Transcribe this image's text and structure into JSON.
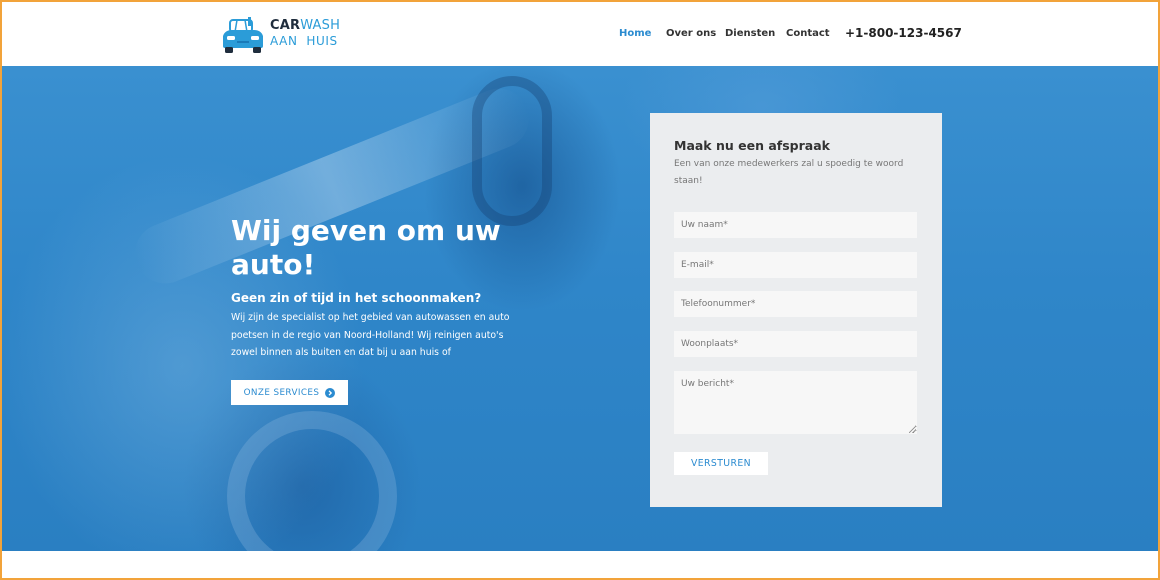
{
  "logo": {
    "text_bold": "CAR",
    "text_light": "WASH",
    "text_sub": "AAN  HUIS",
    "icon": "car-icon",
    "color_dark": "#1f2d3d",
    "color_accent": "#2b9cd8"
  },
  "nav": {
    "items": [
      {
        "label": "Home",
        "active": true
      },
      {
        "label": "Over ons",
        "active": false
      },
      {
        "label": "Diensten",
        "active": false
      },
      {
        "label": "Contact",
        "active": false
      }
    ],
    "phone": "+1-800-123-4567"
  },
  "hero": {
    "title": "Wij geven om uw auto!",
    "subtitle": "Geen zin of tijd in het schoonmaken?",
    "body": "Wij zijn de specialist op het gebied van autowassen en auto poetsen in de regio van Noord-Holland! Wij reinigen auto's zowel binnen als buiten en dat bij u aan huis of",
    "button_label": "ONZE SERVICES",
    "button_icon": "arrow-circle-right-icon",
    "background_color": "#2f86c9"
  },
  "form": {
    "title": "Maak nu een afspraak",
    "description": "Een van onze medewerkers zal u spoedig te woord staan!",
    "fields": {
      "name_placeholder": "Uw naam*",
      "email_placeholder": "E-mail*",
      "phone_placeholder": "Telefoonummer*",
      "city_placeholder": "Woonplaats*",
      "message_placeholder": "Uw bericht*"
    },
    "submit_label": "VERSTUREN",
    "card_color": "#ebedef",
    "accent_color": "#2b8bd0"
  }
}
